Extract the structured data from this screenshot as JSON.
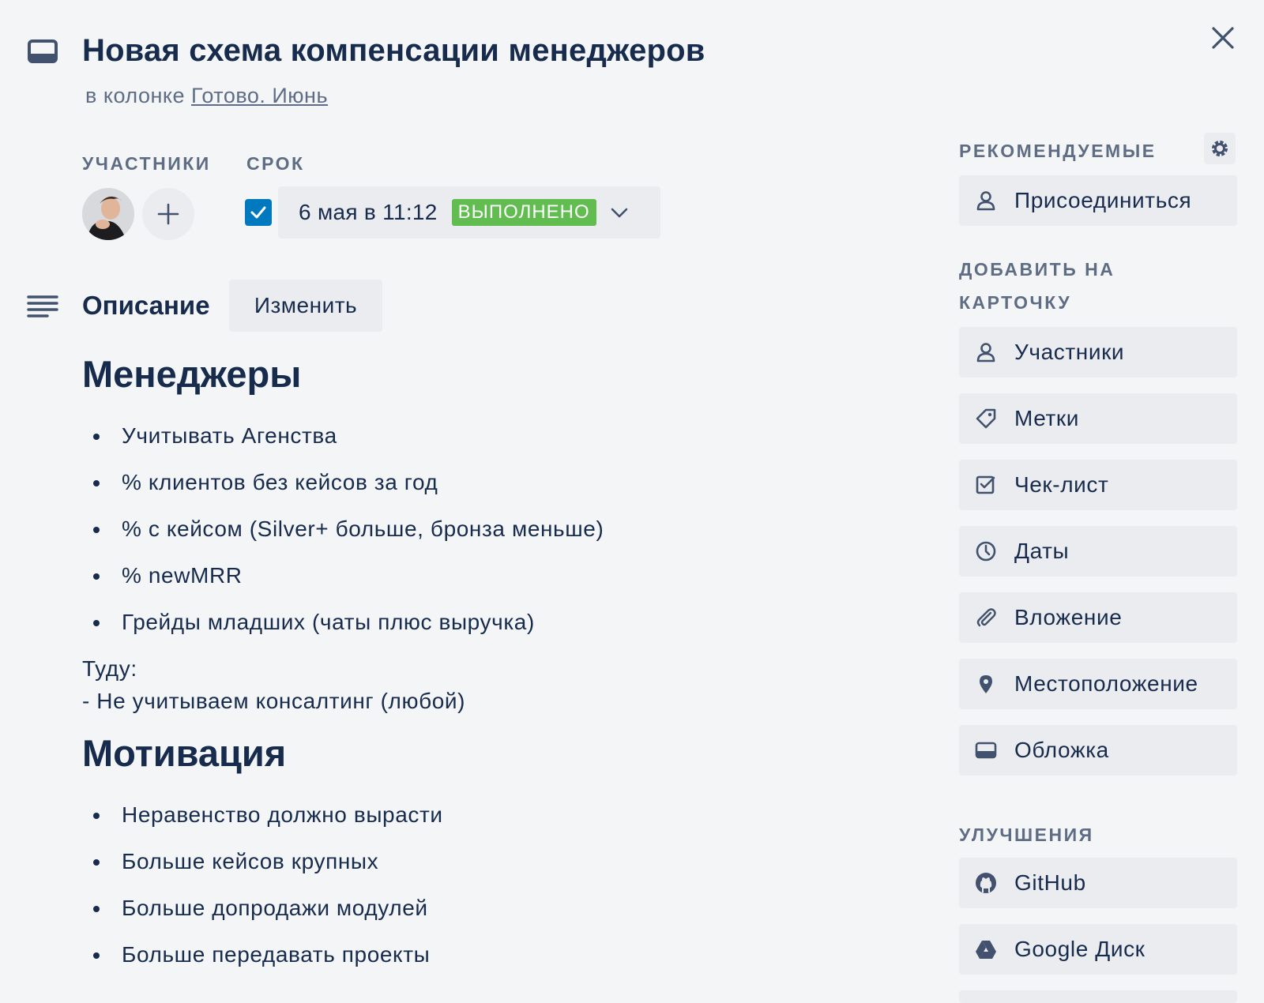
{
  "card": {
    "title": "Новая схема компенсации менеджеров",
    "list_prefix": "в колонке",
    "list_name": "Готово. Июнь"
  },
  "members": {
    "label": "УЧАСТНИКИ",
    "add_label": "+"
  },
  "due": {
    "label": "СРОК",
    "checked": true,
    "date_text": "6 мая в 11:12",
    "status_badge": "ВЫПОЛНЕНО",
    "badge_color": "#61bd4f"
  },
  "description": {
    "title": "Описание",
    "edit_label": "Изменить",
    "sections": [
      {
        "heading": "Менеджеры",
        "bullets": [
          "Учитывать Агенства",
          "% клиентов без кейсов за год",
          "% с кейсом (Silver+ больше, бронза меньше)",
          "% newMRR",
          "Грейды младших (чаты плюс выручка)"
        ],
        "paragraph_lines": [
          "Туду:",
          "- Не учитываем консалтинг (любой)"
        ]
      },
      {
        "heading": "Мотивация",
        "bullets": [
          "Неравенство должно вырасти",
          "Больше кейсов крупных",
          "Больше допродажи модулей",
          "Больше передавать проекты"
        ]
      }
    ]
  },
  "sidebar": {
    "recommended_label": "РЕКОМЕНДУЕМЫЕ",
    "join_label": "Присоединиться",
    "add_to_card_label_line1": "ДОБАВИТЬ НА",
    "add_to_card_label_line2": "КАРТОЧКУ",
    "add_items": [
      {
        "label": "Участники",
        "icon": "person-icon"
      },
      {
        "label": "Метки",
        "icon": "tag-icon"
      },
      {
        "label": "Чек-лист",
        "icon": "checklist-icon"
      },
      {
        "label": "Даты",
        "icon": "clock-icon"
      },
      {
        "label": "Вложение",
        "icon": "paperclip-icon"
      },
      {
        "label": "Местоположение",
        "icon": "location-pin-icon"
      },
      {
        "label": "Обложка",
        "icon": "cover-icon"
      }
    ],
    "powerups_label": "УЛУЧШЕНИЯ",
    "powerups": [
      {
        "label": "GitHub",
        "icon": "github-icon"
      },
      {
        "label": "Google Диск",
        "icon": "google-drive-icon"
      }
    ]
  },
  "colors": {
    "background": "#f4f5f7",
    "button_bg": "#ebecf0",
    "text": "#172b4d",
    "muted": "#5e6c84",
    "checkbox_blue": "#0079bf"
  }
}
